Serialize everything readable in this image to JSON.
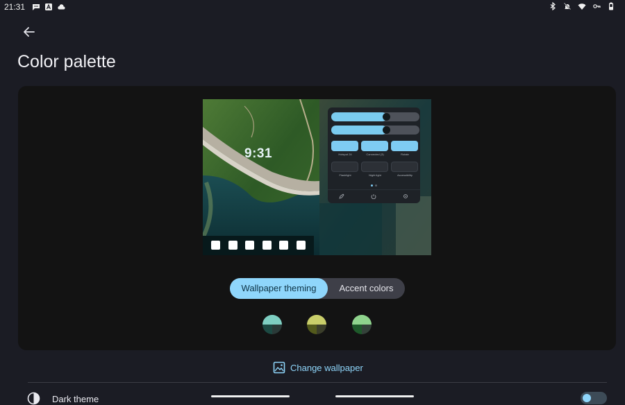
{
  "status_bar": {
    "time": "21:31",
    "notification_icons": [
      "chat-bubble-icon",
      "font-app-icon",
      "cloud-icon"
    ],
    "system_icons": [
      "bluetooth-icon",
      "do-not-disturb-off-icon",
      "wifi-icon",
      "vpn-key-icon",
      "battery-icon"
    ]
  },
  "header": {
    "back_icon": "arrow-left-icon",
    "title": "Color palette"
  },
  "preview": {
    "lock_clock": "9:31",
    "quick_settings": {
      "sliders": [
        {
          "name": "brightness",
          "level": 0.63
        },
        {
          "name": "volume",
          "level": 0.63
        }
      ],
      "tiles": [
        {
          "label": "Hotspot 24",
          "state": "on"
        },
        {
          "label": "Connected (3)",
          "state": "on"
        },
        {
          "label": "Rotate",
          "state": "on"
        },
        {
          "label": "Flashlight",
          "state": "off"
        },
        {
          "label": "Night light",
          "state": "off"
        },
        {
          "label": "Accessibility",
          "state": "off"
        }
      ]
    },
    "dock_icon_count": 6
  },
  "theme_toggle": {
    "options": [
      "Wallpaper theming",
      "Accent colors"
    ],
    "selected": "Wallpaper theming"
  },
  "swatches": [
    {
      "name": "teal",
      "top": "#7ecfc2",
      "bottom_left": "#1c4a43",
      "bottom_right": "#2a3a38"
    },
    {
      "name": "olive",
      "top": "#c9ce6a",
      "bottom_left": "#535a1c",
      "bottom_right": "#3b3e2a"
    },
    {
      "name": "green",
      "top": "#8fd48d",
      "bottom_left": "#1e5a2a",
      "bottom_right": "#34423a"
    }
  ],
  "actions": {
    "change_wallpaper": "Change wallpaper"
  },
  "settings": {
    "dark_theme_label": "Dark theme",
    "dark_theme_enabled": true
  },
  "colors": {
    "accent": "#8fd6fb",
    "background": "#1b1c24",
    "card": "#131313"
  }
}
